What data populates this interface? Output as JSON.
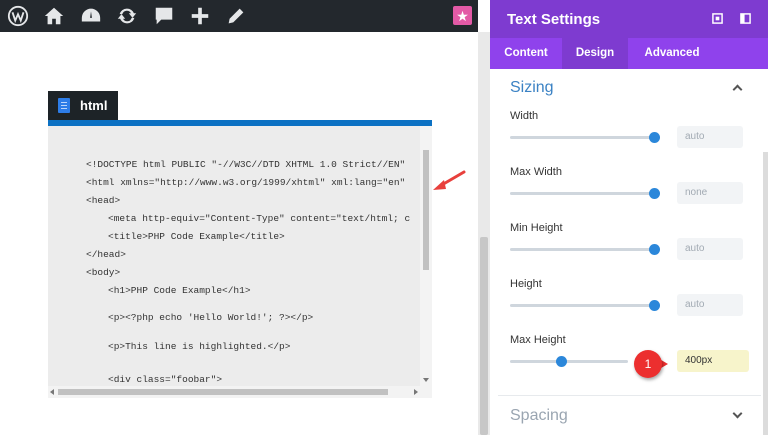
{
  "admin_bar": {
    "icons": [
      "wordpress-icon",
      "home-icon",
      "dashboard-icon",
      "refresh-icon",
      "comment-icon",
      "plus-icon",
      "pencil-icon",
      "star-icon"
    ]
  },
  "module": {
    "tab_label": "html",
    "accent_color": "#0c71c3",
    "code_lines": [
      "<!DOCTYPE html PUBLIC \"-//W3C//DTD XHTML 1.0 Strict//EN\"",
      "<html xmlns=\"http://www.w3.org/1999/xhtml\" xml:lang=\"en\"",
      "<head>",
      "<meta http-equiv=\"Content-Type\" content=\"text/html; c",
      "<title>PHP Code Example</title>",
      "</head>",
      "<body>",
      "<h1>PHP Code Example</h1>",
      "<p><?php echo 'Hello World!'; ?></p>",
      "<p>This line is highlighted.</p>",
      "<div class=\"foobar\">"
    ]
  },
  "panel": {
    "title": "Text Settings",
    "header_color": "#7e3bd0",
    "tabs": [
      {
        "label": "Content",
        "active": false
      },
      {
        "label": "Design",
        "active": true
      },
      {
        "label": "Advanced",
        "active": false
      }
    ],
    "sections": {
      "sizing": "Sizing",
      "spacing": "Spacing"
    },
    "fields": [
      {
        "label": "Width",
        "value": "auto"
      },
      {
        "label": "Max Width",
        "value": "none"
      },
      {
        "label": "Min Height",
        "value": "auto"
      },
      {
        "label": "Height",
        "value": "auto"
      },
      {
        "label": "Max Height",
        "value": "400px"
      }
    ],
    "callout_number": "1"
  }
}
